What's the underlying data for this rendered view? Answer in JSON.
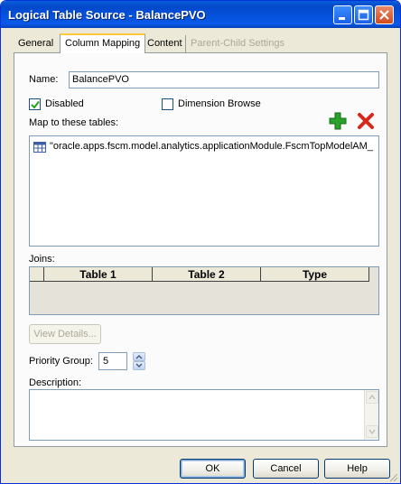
{
  "window": {
    "title": "Logical Table Source - BalancePVO"
  },
  "tabs": [
    {
      "label": "General",
      "active": false,
      "disabled": false
    },
    {
      "label": "Column Mapping",
      "active": true,
      "disabled": false
    },
    {
      "label": "Content",
      "active": false,
      "disabled": false
    },
    {
      "label": "Parent-Child Settings",
      "active": false,
      "disabled": true
    }
  ],
  "general": {
    "name_label": "Name:",
    "name_value": "BalancePVO",
    "disabled_label": "Disabled",
    "disabled_checked": true,
    "dimension_browse_label": "Dimension Browse",
    "dimension_browse_checked": false,
    "map_tables_label": "Map to these tables:",
    "tables": [
      "\"oracle.apps.fscm.model.analytics.applicationModule.FscmTopModelAM_F..."
    ],
    "joins_label": "Joins:",
    "joins_columns": [
      "Table 1",
      "Table 2",
      "Type"
    ],
    "view_details_label": "View Details...",
    "priority_group_label": "Priority Group:",
    "priority_group_value": "5",
    "description_label": "Description:",
    "description_value": ""
  },
  "buttons": {
    "ok": "OK",
    "cancel": "Cancel",
    "help": "Help"
  },
  "colors": {
    "title_bar": "#0553e0",
    "dialog_bg": "#ece9d8",
    "add_icon": "#2aa12a",
    "delete_icon": "#d8281b"
  }
}
